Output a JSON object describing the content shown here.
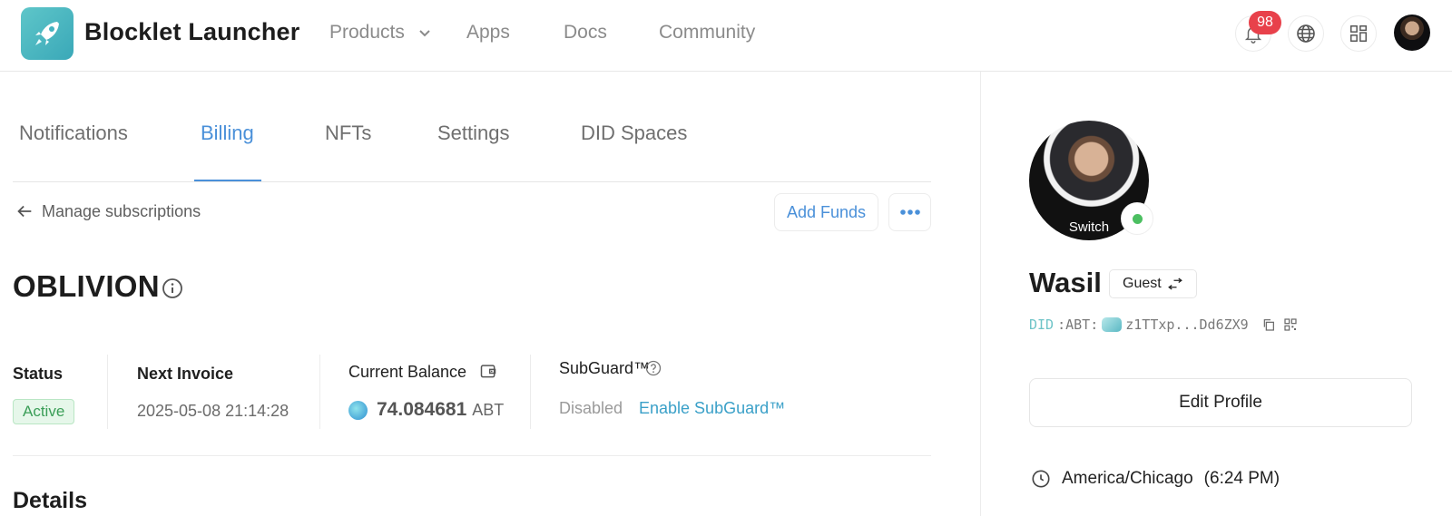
{
  "header": {
    "app_title": "Blocklet Launcher",
    "nav": [
      "Products",
      "Apps",
      "Docs",
      "Community"
    ],
    "notification_count": "98"
  },
  "tabs": [
    "Notifications",
    "Billing",
    "NFTs",
    "Settings",
    "DID Spaces"
  ],
  "active_tab": "Billing",
  "subscription": {
    "back_label": "Manage subscriptions",
    "add_funds": "Add Funds",
    "name": "OBLIVION",
    "status_label": "Status",
    "status_value": "Active",
    "next_invoice_label": "Next Invoice",
    "next_invoice_value": "2025-05-08 21:14:28",
    "balance_label": "Current Balance",
    "balance_value": "74.084681",
    "balance_unit": "ABT",
    "subguard_label": "SubGuard™",
    "subguard_status": "Disabled",
    "subguard_action": "Enable SubGuard™",
    "details_heading": "Details"
  },
  "profile": {
    "switch_label": "Switch",
    "name": "Wasil",
    "role": "Guest",
    "did_prefix": "DID",
    "did_chain": ":ABT:",
    "did_short": "z1TTxp...Dd6ZX9",
    "edit_profile": "Edit Profile",
    "timezone": "America/Chicago",
    "local_time": "(6:24 PM)"
  },
  "colors": {
    "accent": "#4a90d9",
    "status_active": "#3a9e57",
    "badge": "#e8414b",
    "online": "#4cbf61",
    "link": "#3aa0c8"
  }
}
